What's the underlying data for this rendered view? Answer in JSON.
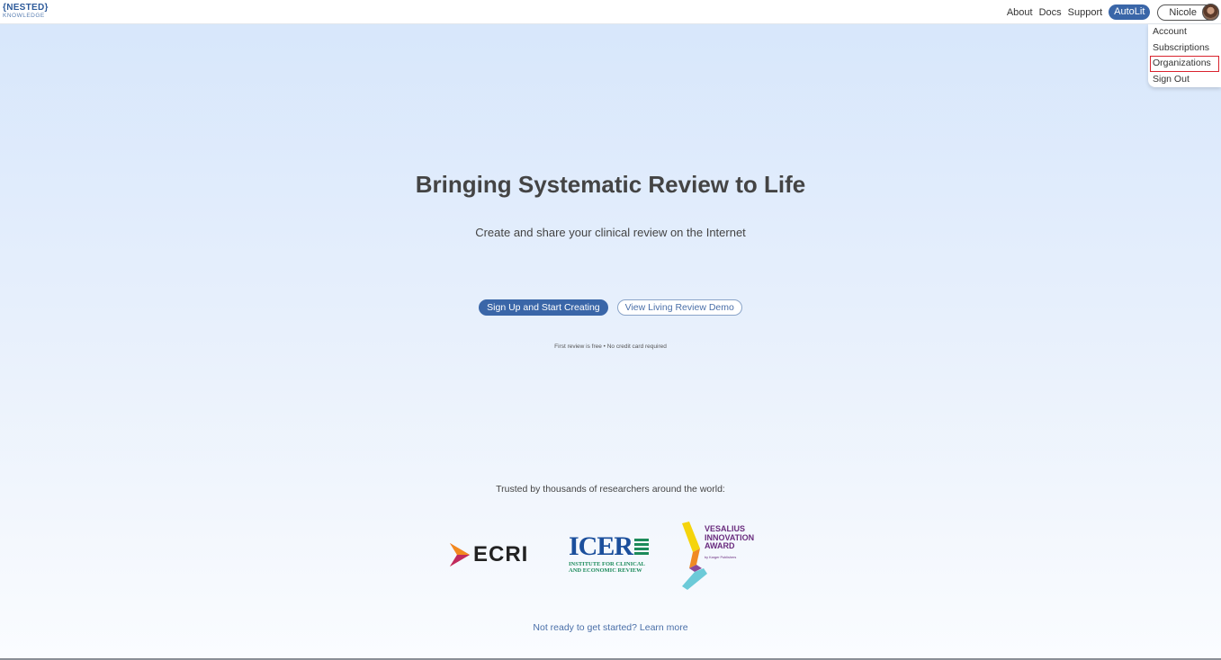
{
  "header": {
    "logo_main": "{NESTED}",
    "logo_sub": "KNOWLEDGE",
    "nav": [
      "About",
      "Docs",
      "Support"
    ],
    "autolit_label": "AutoLit",
    "user_name": "Nicole"
  },
  "user_menu": {
    "items": [
      "Account",
      "Subscriptions",
      "Organizations",
      "Sign Out"
    ],
    "highlighted": "Organizations"
  },
  "hero": {
    "title": "Bringing Systematic Review to Life",
    "subtitle": "Create and share your clinical review on the Internet",
    "primary_cta": "Sign Up and Start Creating",
    "secondary_cta": "View Living Review Demo",
    "note": "First review is free • No credit card required"
  },
  "trust": {
    "heading": "Trusted by thousands of researchers around the world:",
    "ecri": "ECRI",
    "icer": "ICER",
    "icer_sub_1": "INSTITUTE FOR CLINICAL",
    "icer_sub_2": "AND ECONOMIC REVIEW",
    "vesalius_1": "VESALIUS",
    "vesalius_2": "INNOVATION",
    "vesalius_3": "AWARD",
    "vesalius_by": "by Karger Publishers"
  },
  "footer_link": "Not ready to get started? Learn more",
  "colors": {
    "brand_blue": "#3a66a8",
    "highlight_red": "#d9232e",
    "icer_blue": "#1b4f9c",
    "icer_green": "#1c8a5a",
    "vesalius_purple": "#6a2c7e"
  }
}
